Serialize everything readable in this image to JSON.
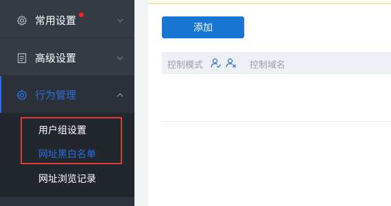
{
  "sidebar": {
    "items": [
      {
        "label": "常用设置",
        "icon": "gear-icon",
        "badge_color": "#f5222d"
      },
      {
        "label": "高级设置",
        "icon": "document-icon"
      },
      {
        "label": "行为管理",
        "icon": "target-icon",
        "active": true
      }
    ],
    "submenu": [
      {
        "label": "用户组设置"
      },
      {
        "label": "网址黑白名单",
        "active": true
      },
      {
        "label": "网址浏览记录"
      }
    ]
  },
  "toolbar": {
    "add_label": "添加"
  },
  "table": {
    "columns": [
      {
        "label": "控制模式",
        "icons": [
          "user-check-icon",
          "user-x-icon"
        ]
      },
      {
        "label": "控制域名"
      }
    ],
    "rows": []
  },
  "colors": {
    "accent": "#2a6ee0",
    "button": "#1676d2",
    "highlight": "#e53935",
    "sidebar": "#353b45"
  }
}
